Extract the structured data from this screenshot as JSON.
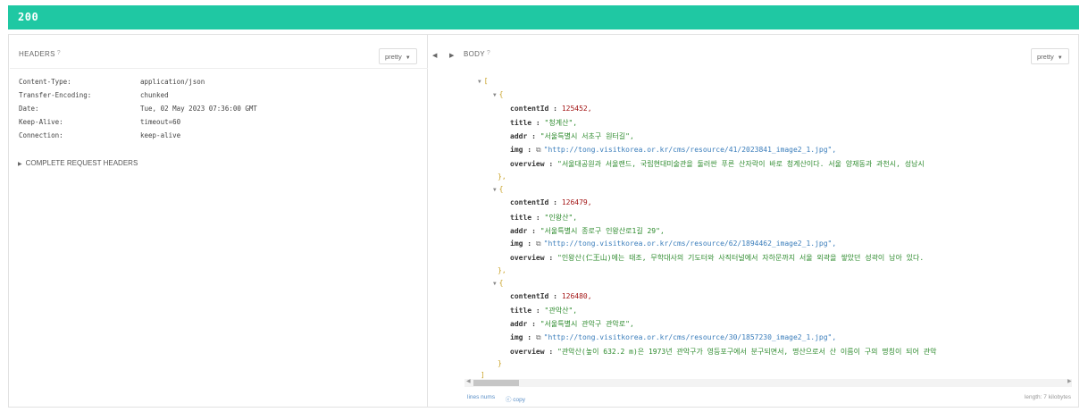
{
  "status_code": "200",
  "headers_panel": {
    "title": "HEADERS",
    "help": "?",
    "pretty_label": "pretty",
    "caret": "▼",
    "rows": [
      {
        "key": "Content-Type:",
        "value": "application/json"
      },
      {
        "key": "Transfer-Encoding:",
        "value": "chunked"
      },
      {
        "key": "Date:",
        "value": "Tue, 02 May 2023 07:36:00 GMT"
      },
      {
        "key": "Keep-Alive:",
        "value": "timeout=60"
      },
      {
        "key": "Connection:",
        "value": "keep-alive"
      }
    ],
    "complete_label": "COMPLETE REQUEST HEADERS",
    "complete_icon": "▶"
  },
  "collapse_left_icon": "◀",
  "collapse_right_icon": "▶",
  "body_panel": {
    "title": "BODY",
    "help": "?",
    "pretty_label": "pretty",
    "caret": "▼",
    "fold_icon": "▼",
    "ext_icon": "⧉",
    "open_bracket": "[",
    "close_bracket": "]",
    "open_brace": "{",
    "close_brace": "}",
    "close_brace_comma": "},",
    "key_content_id": "contentId :",
    "key_title": "title :",
    "key_addr": "addr :",
    "key_img": "img :",
    "key_overview": "overview :",
    "items": [
      {
        "contentId": "125452,",
        "title": "\"청계산\",",
        "addr": "\"서울특별시 서초구 원터길\",",
        "img": "\"http://tong.visitkorea.or.kr/cms/resource/41/2023841_image2_1.jpg\",",
        "overview": "\"서울대공원과 서울랜드, 국립현대미술관을 둘러싼 푸른 산자락이 바로 청계산이다. 서울 양재동과 과천시, 성남시"
      },
      {
        "contentId": "126479,",
        "title": "\"인왕산\",",
        "addr": "\"서울특별시 종로구 인왕산로1길 29\",",
        "img": "\"http://tong.visitkorea.or.kr/cms/resource/62/1894462_image2_1.jpg\",",
        "overview": "\"인왕산(仁王山)에는 태조, 무학대사의 기도터와 사직터널에서 자하문까지 서울 외곽을 쌓았던 성곽이 남아 있다."
      },
      {
        "contentId": "126480,",
        "title": "\"관악산\",",
        "addr": "\"서울특별시 관악구 관악로\",",
        "img": "\"http://tong.visitkorea.or.kr/cms/resource/30/1857230_image2_1.jpg\",",
        "overview": "\"관악산(높이 632.2 m)은 1973년 관악구가 영등포구에서 분구되면서, 명산으로서 산 이름이 구의 명칭이 되어 관악"
      }
    ]
  },
  "scroll_left_icon": "◀",
  "scroll_right_icon": "▶",
  "footer": {
    "line_nums": "lines nums",
    "copy": "ⓒ copy",
    "length": "length: 7 kilobytes"
  },
  "colors": {
    "status_bar": "#1fc8a3",
    "json_key": "#333333",
    "json_number": "#a31515",
    "json_string": "#2e8b2e",
    "json_url": "#3a7dbb",
    "json_bracket": "#c9a227"
  }
}
